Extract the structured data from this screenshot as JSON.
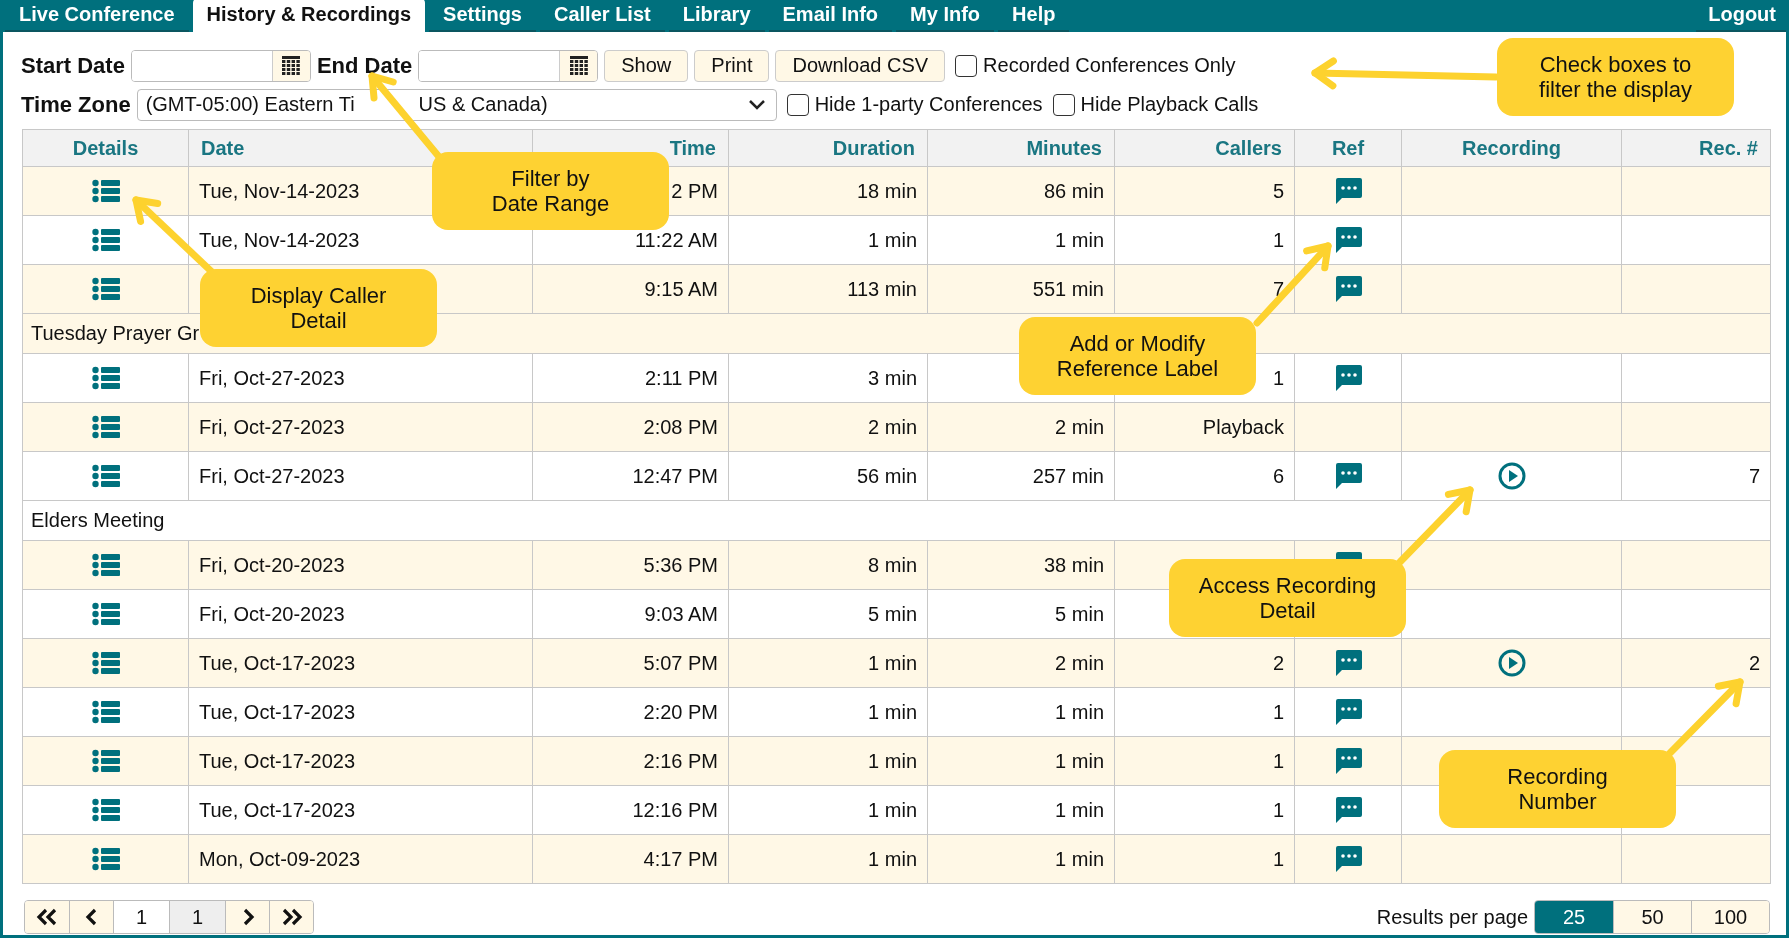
{
  "nav": {
    "tabs": [
      {
        "label": "Live Conference",
        "selected": false
      },
      {
        "label": "History & Recordings",
        "selected": true
      },
      {
        "label": "Settings",
        "selected": false
      },
      {
        "label": "Caller List",
        "selected": false
      },
      {
        "label": "Library",
        "selected": false
      },
      {
        "label": "Email Info",
        "selected": false
      },
      {
        "label": "My Info",
        "selected": false
      },
      {
        "label": "Help",
        "selected": false
      }
    ],
    "logout": "Logout"
  },
  "filters": {
    "start_date": {
      "label": "Start Date"
    },
    "end_date": {
      "label": "End Date"
    },
    "buttons": [
      "Show",
      "Print",
      "Download CSV"
    ],
    "time_zone": {
      "label": "Time Zone",
      "value_parts": [
        "(GMT-05:00) Eastern Ti",
        "US & Canada)"
      ]
    },
    "checkboxes": [
      {
        "label": "Recorded Conferences Only",
        "checked": false
      },
      {
        "label": "Hide 1-party Conferences",
        "checked": false
      },
      {
        "label": "Hide Playback Calls",
        "checked": false
      }
    ]
  },
  "table": {
    "columns": [
      "Details",
      "Date",
      "Time",
      "Duration",
      "Minutes",
      "Callers",
      "Ref",
      "Recording",
      "Rec. #"
    ],
    "rows": [
      {
        "kind": "call",
        "shaded": true,
        "date": "Tue, Nov-14-2023",
        "time": "2 PM",
        "duration": "18 min",
        "minutes": "86 min",
        "callers": "5",
        "ref": true,
        "recording": false
      },
      {
        "kind": "call",
        "shaded": false,
        "date": "Tue, Nov-14-2023",
        "time": "11:22 AM",
        "duration": "1 min",
        "minutes": "1 min",
        "callers": "1",
        "ref": true,
        "recording": false
      },
      {
        "kind": "call",
        "shaded": true,
        "time": "9:15 AM",
        "duration": "113 min",
        "minutes": "551 min",
        "callers": "7",
        "ref": true,
        "recording": false
      },
      {
        "kind": "group",
        "shaded": true,
        "label": "Tuesday Prayer Gr"
      },
      {
        "kind": "call",
        "shaded": false,
        "date": "Fri, Oct-27-2023",
        "time": "2:11 PM",
        "duration": "3 min",
        "callers": "1",
        "ref": true,
        "recording": false
      },
      {
        "kind": "call",
        "shaded": true,
        "date": "Fri, Oct-27-2023",
        "time": "2:08 PM",
        "duration": "2 min",
        "minutes": "2 min",
        "callers": "Playback",
        "ref": false,
        "recording": false
      },
      {
        "kind": "call",
        "shaded": false,
        "date": "Fri, Oct-27-2023",
        "time": "12:47 PM",
        "duration": "56 min",
        "minutes": "257 min",
        "callers": "6",
        "ref": true,
        "recording": true,
        "rec_no": "7"
      },
      {
        "kind": "group",
        "shaded": false,
        "label": "Elders Meeting"
      },
      {
        "kind": "call",
        "shaded": true,
        "date": "Fri, Oct-20-2023",
        "time": "5:36 PM",
        "duration": "8 min",
        "minutes": "38 min",
        "ref": true,
        "recording": false
      },
      {
        "kind": "call",
        "shaded": false,
        "date": "Fri, Oct-20-2023",
        "time": "9:03 AM",
        "duration": "5 min",
        "minutes": "5 min",
        "ref": false,
        "recording": false
      },
      {
        "kind": "call",
        "shaded": true,
        "date": "Tue, Oct-17-2023",
        "time": "5:07 PM",
        "duration": "1 min",
        "minutes": "2 min",
        "callers": "2",
        "ref": true,
        "recording": true,
        "rec_no": "2"
      },
      {
        "kind": "call",
        "shaded": false,
        "date": "Tue, Oct-17-2023",
        "time": "2:20 PM",
        "duration": "1 min",
        "minutes": "1 min",
        "callers": "1",
        "ref": true,
        "recording": false
      },
      {
        "kind": "call",
        "shaded": true,
        "date": "Tue, Oct-17-2023",
        "time": "2:16 PM",
        "duration": "1 min",
        "minutes": "1 min",
        "callers": "1",
        "ref": true,
        "recording": false
      },
      {
        "kind": "call",
        "shaded": false,
        "date": "Tue, Oct-17-2023",
        "time": "12:16 PM",
        "duration": "1 min",
        "minutes": "1 min",
        "callers": "1",
        "ref": true,
        "recording": false
      },
      {
        "kind": "call",
        "shaded": true,
        "date": "Mon, Oct-09-2023",
        "time": "4:17 PM",
        "duration": "1 min",
        "minutes": "1 min",
        "callers": "1",
        "ref": true,
        "recording": false
      }
    ]
  },
  "pager": {
    "page": "1",
    "pages": "1",
    "results_label": "Results per page",
    "page_sizes": [
      {
        "label": "25",
        "selected": true
      },
      {
        "label": "50",
        "selected": false
      },
      {
        "label": "100",
        "selected": false
      }
    ]
  },
  "callouts": [
    {
      "text": "Check boxes to\nfilter the display"
    },
    {
      "text": "Filter by\nDate Range"
    },
    {
      "text": "Display Caller\nDetail"
    },
    {
      "text": "Add or Modify\nReference Label"
    },
    {
      "text": "Access Recording\nDetail"
    },
    {
      "text": "Recording\nNumber"
    }
  ]
}
